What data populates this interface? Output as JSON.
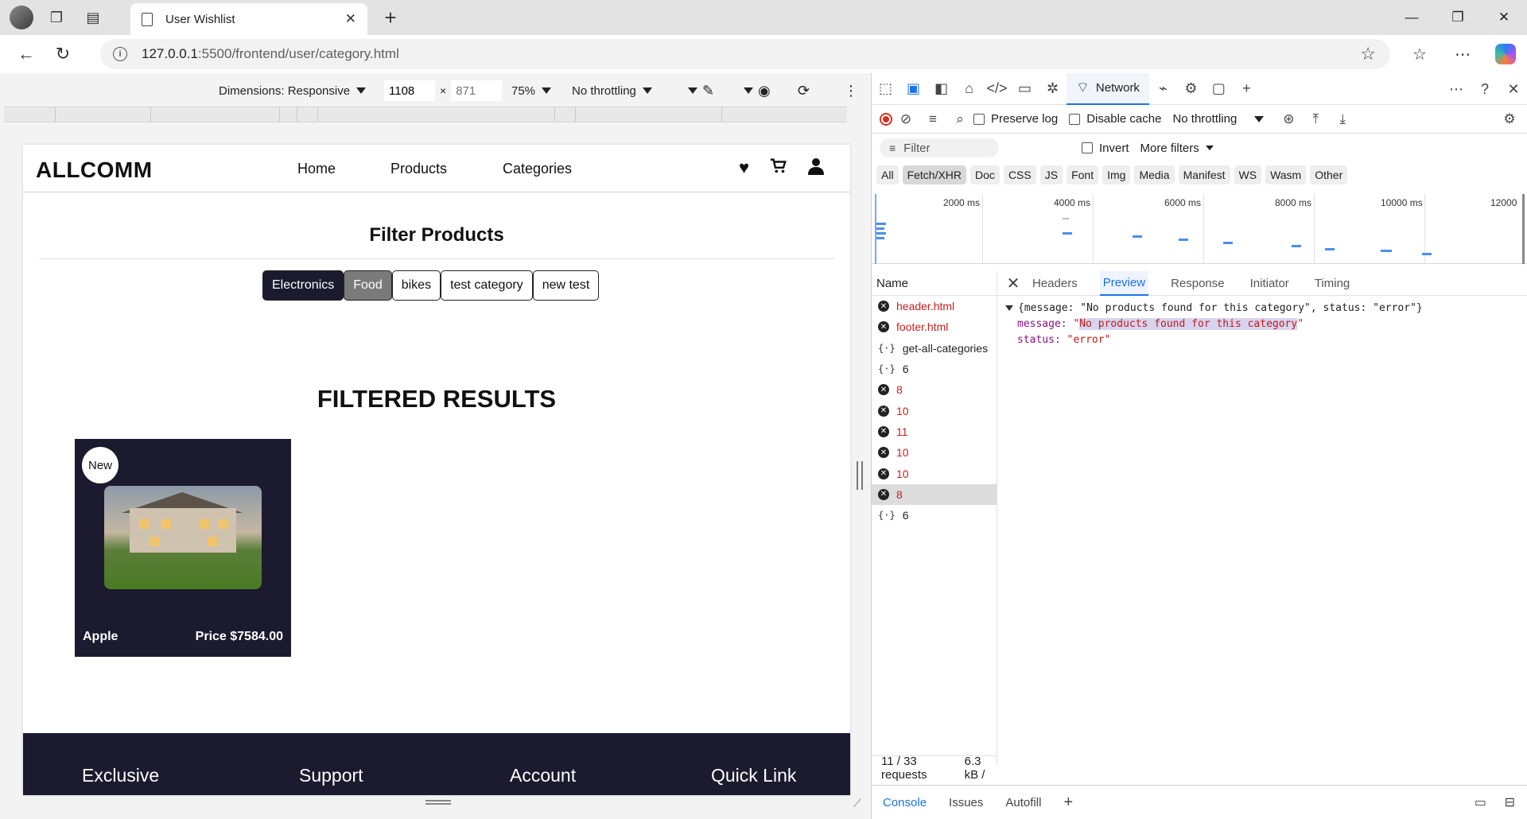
{
  "browser": {
    "tab_title": "User Wishlist",
    "url_host": "127.0.0.1",
    "url_path": ":5500/frontend/user/category.html"
  },
  "device_toolbar": {
    "dimensions_label": "Dimensions: Responsive",
    "width": "1108",
    "height_placeholder": "871",
    "zoom": "75%",
    "throttling": "No throttling"
  },
  "site": {
    "logo": "ALLCOMM",
    "nav": [
      "Home",
      "Products",
      "Categories"
    ],
    "filter_title": "Filter Products",
    "categories": [
      {
        "label": "Electronics",
        "state": "active"
      },
      {
        "label": "Food",
        "state": "hover"
      },
      {
        "label": "bikes",
        "state": "normal"
      },
      {
        "label": "test category",
        "state": "normal"
      },
      {
        "label": "new test",
        "state": "normal"
      }
    ],
    "results_title": "FILTERED RESULTS",
    "product": {
      "badge": "New",
      "name": "Apple",
      "price": "Price $7584.00"
    },
    "footer": [
      "Exclusive",
      "Support",
      "Account",
      "Quick Link"
    ]
  },
  "devtools": {
    "network_tab": "Network",
    "preserve_log": "Preserve log",
    "disable_cache": "Disable cache",
    "throttling": "No throttling",
    "filter_placeholder": "Filter",
    "invert": "Invert",
    "more_filters": "More filters",
    "type_filters": [
      "All",
      "Fetch/XHR",
      "Doc",
      "CSS",
      "JS",
      "Font",
      "Img",
      "Media",
      "Manifest",
      "WS",
      "Wasm",
      "Other"
    ],
    "active_type": "Fetch/XHR",
    "timeline_labels": [
      "2000 ms",
      "4000 ms",
      "6000 ms",
      "8000 ms",
      "10000 ms",
      "12000"
    ],
    "name_header": "Name",
    "requests": [
      {
        "name": "header.html",
        "status": "error"
      },
      {
        "name": "footer.html",
        "status": "error"
      },
      {
        "name": "get-all-categories",
        "status": "ok"
      },
      {
        "name": "6",
        "status": "ok"
      },
      {
        "name": "8",
        "status": "error"
      },
      {
        "name": "10",
        "status": "error"
      },
      {
        "name": "11",
        "status": "error"
      },
      {
        "name": "10",
        "status": "error"
      },
      {
        "name": "10",
        "status": "error"
      },
      {
        "name": "8",
        "status": "error",
        "selected": true
      },
      {
        "name": "6",
        "status": "ok"
      }
    ],
    "detail_tabs": [
      "Headers",
      "Preview",
      "Response",
      "Initiator",
      "Timing"
    ],
    "active_detail_tab": "Preview",
    "preview": {
      "summary": "{message: \"No products found for this category\", status: \"error\"}",
      "message_key": "message:",
      "message_value": "No products found for this category",
      "status_key": "status:",
      "status_value": "\"error\""
    },
    "request_count": "11 / 33 requests",
    "transfer_size": "6.3 kB /",
    "drawer_tabs": [
      "Console",
      "Issues",
      "Autofill"
    ]
  }
}
